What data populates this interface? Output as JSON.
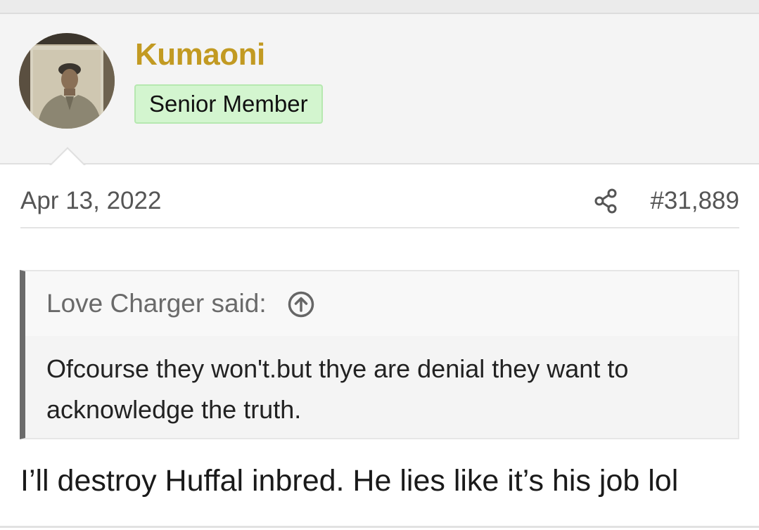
{
  "user": {
    "name": "Kumaoni",
    "name_color": "#c29a22",
    "title_badge": "Senior Member",
    "avatar_icon": "user-avatar-photo"
  },
  "post": {
    "date": "Apr 13, 2022",
    "share_icon": "share-icon",
    "number": "#31,889",
    "body": "I’ll destroy Huffal inbred. He lies like it’s his job lol"
  },
  "quote": {
    "author_label": "Love Charger said:",
    "jump_icon": "arrow-up-circle-icon",
    "text": "Ofcourse they won't.but thye are denial they want to acknowledge the truth."
  }
}
